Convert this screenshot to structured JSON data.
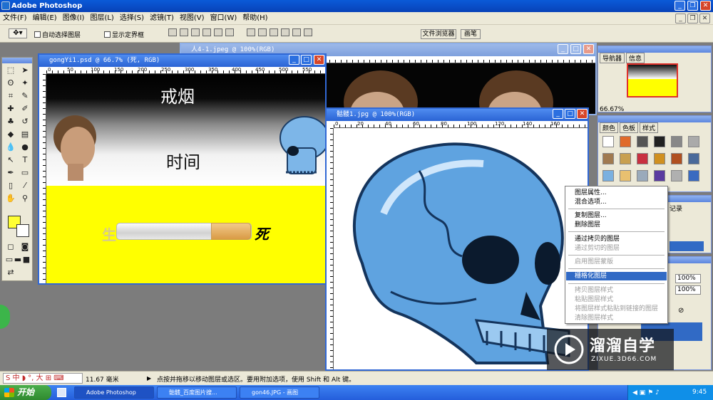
{
  "app": {
    "title": "Adobe Photoshop"
  },
  "menu": [
    "文件(F)",
    "编辑(E)",
    "图像(I)",
    "图层(L)",
    "选择(S)",
    "滤镜(T)",
    "视图(V)",
    "窗口(W)",
    "帮助(H)"
  ],
  "options": {
    "auto_select_label": "自动选择图层",
    "show_bounds_label": "显示定界框",
    "file_browser_tab": "文件浏览器",
    "brushes_tab": "画笔"
  },
  "documents": {
    "bg_doc": {
      "title": "人4-1.jpeg @ 100%(RGB)"
    },
    "gongyi": {
      "title": "gongYi1.psd @ 66.7% (死, RGB)",
      "ruler": [
        "0",
        "50",
        "100",
        "150",
        "200",
        "250",
        "300",
        "350",
        "400",
        "450",
        "500",
        "550"
      ],
      "heading": "戒烟",
      "subheading": "时间",
      "label_life": "生",
      "label_death": "死"
    },
    "skull_doc": {
      "title": "骷髅1.jpg @ 100%(RGB)",
      "ruler": [
        "0",
        "20",
        "40",
        "60",
        "80",
        "100",
        "120",
        "140",
        "160"
      ]
    }
  },
  "panels": {
    "navigator": {
      "tabs": [
        "导航器",
        "信息"
      ],
      "zoom": "66.67%"
    },
    "styles": {
      "tabs": [
        "颜色",
        "色板",
        "样式"
      ]
    },
    "history": {
      "tab": "记录"
    },
    "layers": {
      "opacity": "100%",
      "fill": "100%"
    }
  },
  "context_menu": {
    "items": [
      {
        "label": "图层属性...",
        "enabled": true
      },
      {
        "label": "混合选项...",
        "enabled": true
      },
      {
        "label": "复制图层...",
        "enabled": true
      },
      {
        "label": "删除图层",
        "enabled": true
      },
      {
        "label": "通过拷贝的图层",
        "enabled": true
      },
      {
        "label": "通过剪切的图层",
        "enabled": false
      },
      {
        "label": "启用图层蒙版",
        "enabled": false
      },
      {
        "label": "栅格化图层",
        "enabled": true,
        "highlighted": true
      },
      {
        "label": "拷贝图层样式",
        "enabled": false
      },
      {
        "label": "粘贴图层样式",
        "enabled": false
      },
      {
        "label": "将图层样式粘贴到链接的图层",
        "enabled": false
      },
      {
        "label": "清除图层样式",
        "enabled": false
      }
    ]
  },
  "status": {
    "zoom": "11.67 毫米",
    "hint": "点按并拖移以移动图层或选区。要用附加选项，使用 Shift 和 Alt 键。"
  },
  "taskbar": {
    "start": "开始",
    "buttons": [
      "Adobe Photoshop",
      "骷髅_百度图片搜...",
      "gon46.JPG - 画图"
    ],
    "clock": "9:45"
  },
  "watermark": {
    "brand": "溜溜自学",
    "url": "ZIXUE.3D66.COM"
  },
  "colors": {
    "accent": "#316ac5",
    "canvas_yellow": "#ffff00",
    "skull_blue": "#5fa3e0",
    "xp_blue": "#245edb",
    "start_green": "#3c9a3c"
  }
}
